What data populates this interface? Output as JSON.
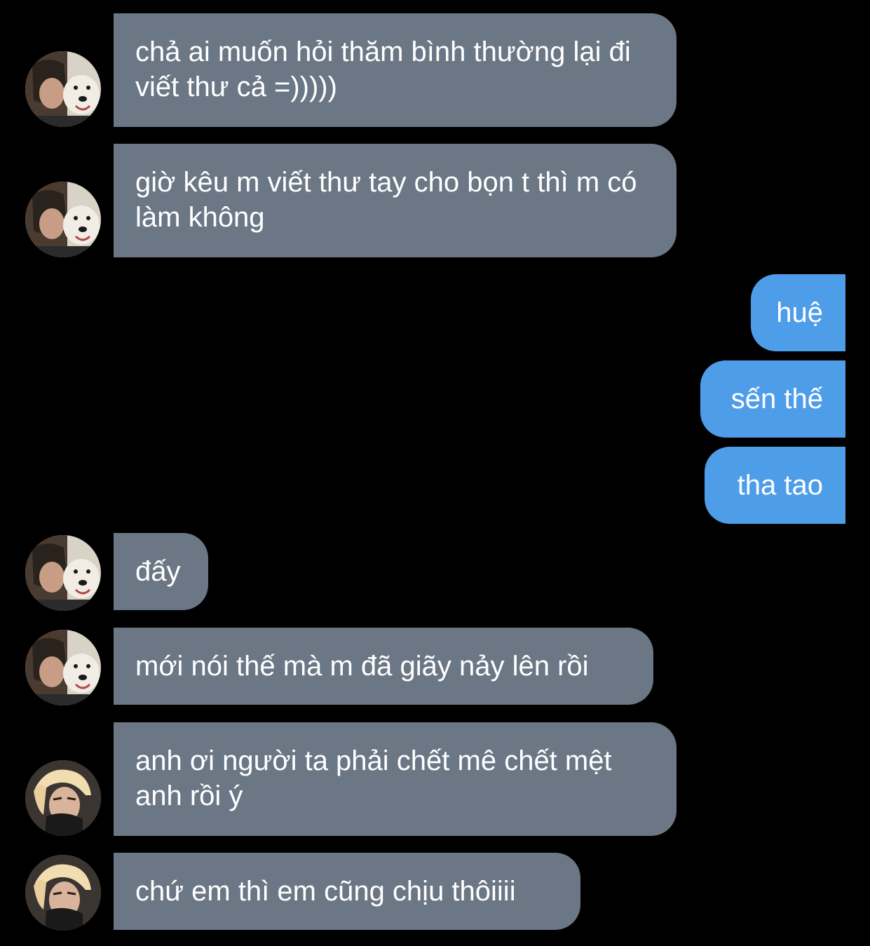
{
  "messages": [
    {
      "direction": "incoming",
      "sender": "dog-avatar",
      "text": "chả ai muốn hỏi thăm bình thường lại đi viết thư cả =)))))"
    },
    {
      "direction": "incoming",
      "sender": "dog-avatar",
      "text": "giờ kêu m viết thư tay cho bọn t thì m có làm không"
    },
    {
      "direction": "outgoing",
      "text": "huệ"
    },
    {
      "direction": "outgoing",
      "text": "sến thế"
    },
    {
      "direction": "outgoing",
      "text": "tha tao"
    },
    {
      "direction": "incoming",
      "sender": "dog-avatar",
      "text": "đấy"
    },
    {
      "direction": "incoming",
      "sender": "dog-avatar",
      "text": "mới nói thế mà m đã giãy nảy lên rồi"
    },
    {
      "direction": "incoming",
      "sender": "blonde-avatar",
      "text": "anh ơi người ta phải chết mê chết mệt anh rồi ý"
    },
    {
      "direction": "incoming",
      "sender": "blonde-avatar",
      "text": "chứ em thì em cũng chịu thôiiii"
    }
  ],
  "colors": {
    "background": "#000000",
    "incoming_bubble": "#6b7785",
    "outgoing_bubble": "#4e9de8",
    "text": "#ffffff"
  }
}
